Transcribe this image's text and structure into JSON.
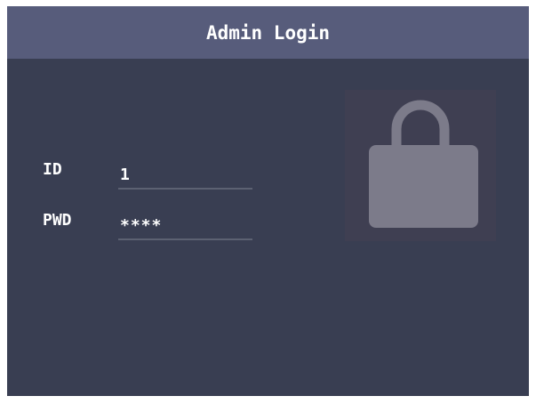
{
  "header": {
    "title": "Admin Login"
  },
  "login": {
    "id_label": "ID",
    "id_value": "1",
    "pwd_label": "PWD",
    "pwd_value": "****"
  },
  "icons": {
    "lock": "lock-icon"
  },
  "colors": {
    "screen_background": "#393e52",
    "title_bar": "#575c7b",
    "lock_fill": "#7c7b8a",
    "lock_panel": "#3f3f52",
    "field_underline": "#5c6172",
    "text": "#ffffff"
  }
}
